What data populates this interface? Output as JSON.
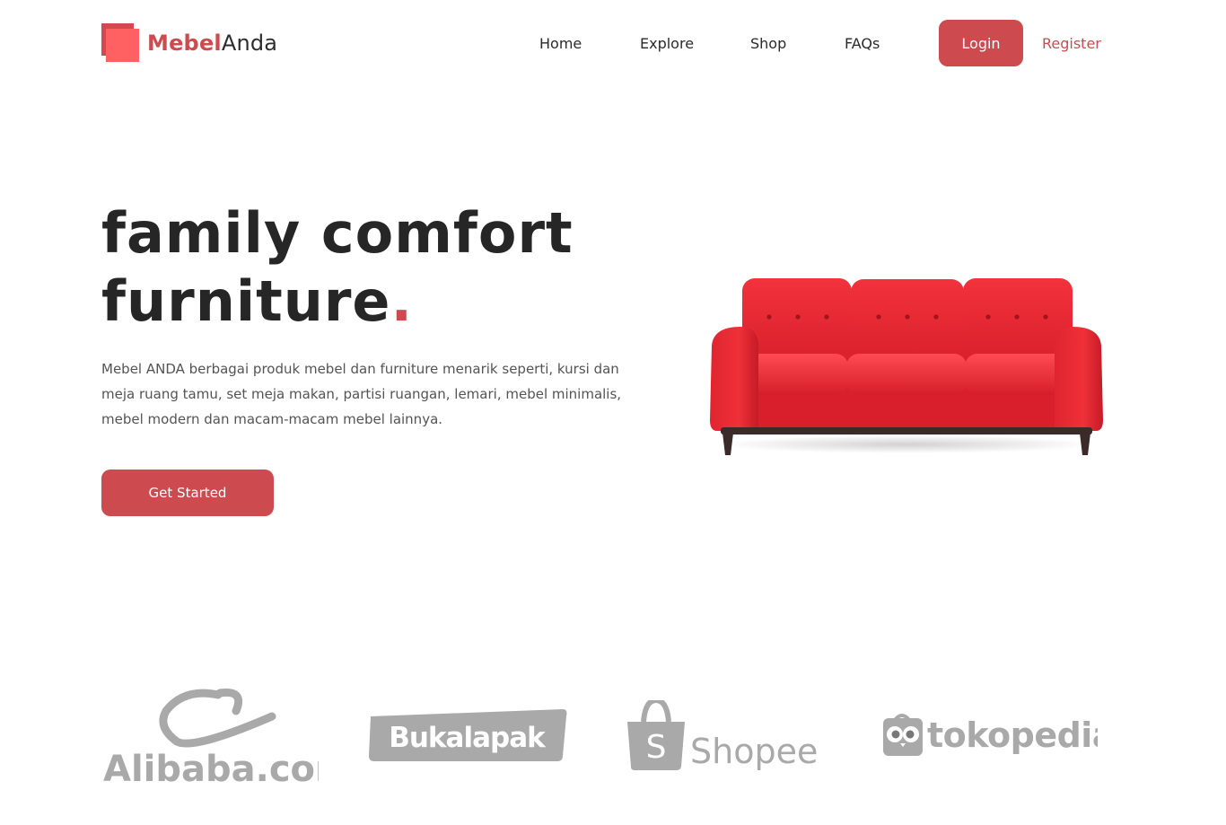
{
  "brand": {
    "name_part1": "Mebel",
    "name_part2": "Anda"
  },
  "nav": {
    "home": "Home",
    "explore": "Explore",
    "shop": "Shop",
    "faqs": "FAQs"
  },
  "auth": {
    "login": "Login",
    "register": "Register"
  },
  "hero": {
    "title_line1": "family comfort",
    "title_line2": "furniture",
    "title_dot": ".",
    "description": "Mebel ANDA berbagai produk mebel dan furniture menarik seperti, kursi dan meja ruang tamu, set meja makan, partisi ruangan, lemari, mebel minimalis, mebel modern dan macam-macam mebel lainnya.",
    "cta": "Get Started"
  },
  "partners": [
    "Alibaba.com",
    "Bukalapak",
    "Shopee",
    "tokopedia"
  ],
  "colors": {
    "accent": "#cd4a4f",
    "logo_light": "#ff6163",
    "partner_gray": "#a9a9a9",
    "sofa_red": "#e0242f"
  },
  "icons": {
    "hero_image": "red-sofa-image"
  }
}
